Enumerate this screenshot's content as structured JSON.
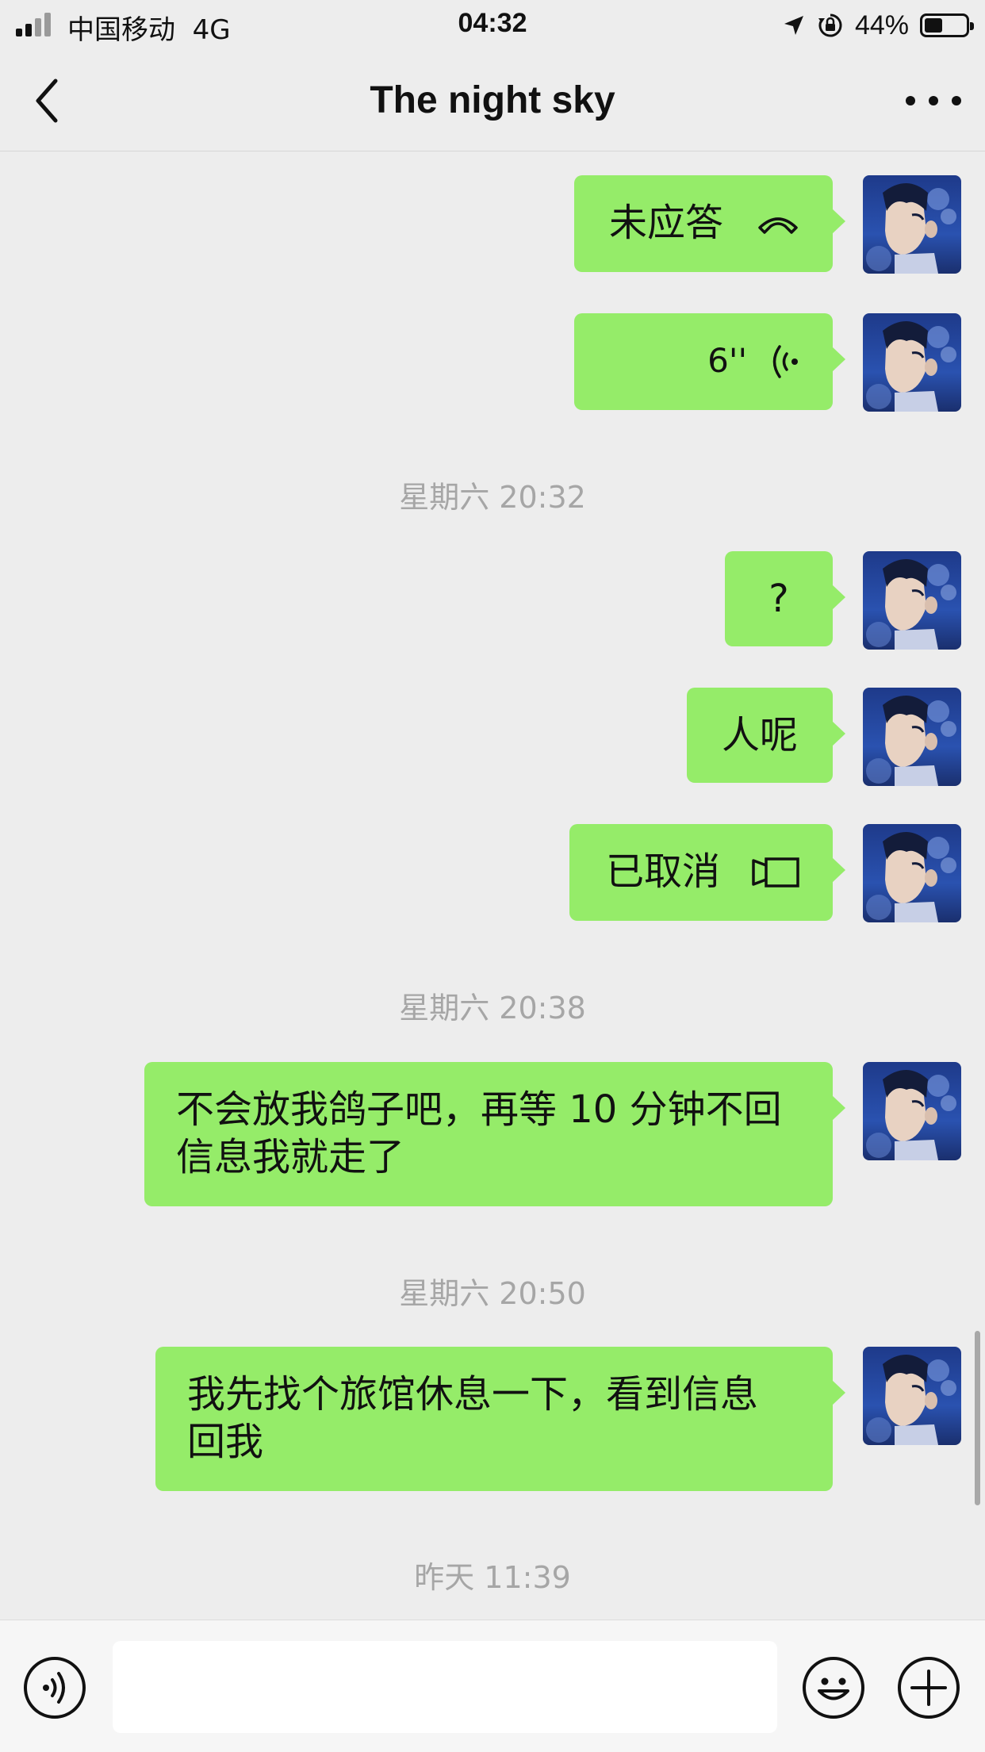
{
  "status_bar": {
    "carrier": "中国移动",
    "network": "4G",
    "time": "04:32",
    "battery_percent": "44%",
    "battery_level": 0.44,
    "icons": [
      "signal-icon",
      "location-arrow-icon",
      "orientation-lock-icon",
      "battery-icon"
    ]
  },
  "header": {
    "title": "The night sky",
    "back_icon": "chevron-left-icon",
    "more_icon": "more-dots-icon"
  },
  "messages": [
    {
      "type": "call",
      "text": "未应答",
      "icon": "phone-hangup-icon"
    },
    {
      "type": "voice",
      "text": "6''",
      "icon": "voice-wave-icon"
    },
    {
      "type": "timestamp",
      "text": "星期六 20:32"
    },
    {
      "type": "text",
      "text": "?"
    },
    {
      "type": "text",
      "text": "人呢"
    },
    {
      "type": "call",
      "text": "已取消",
      "icon": "video-call-icon"
    },
    {
      "type": "timestamp",
      "text": "星期六 20:38"
    },
    {
      "type": "text",
      "lines": [
        "不会放我鸽子吧，再等 10 分钟不回",
        "信息我就走了"
      ]
    },
    {
      "type": "timestamp",
      "text": "星期六 20:50"
    },
    {
      "type": "text",
      "lines": [
        "我先找个旅馆休息一下，看到信息",
        "回我"
      ]
    },
    {
      "type": "timestamp",
      "text": "昨天 11:39"
    }
  ],
  "input_bar": {
    "voice_icon": "voice-input-icon",
    "emoji_icon": "emoji-icon",
    "add_icon": "plus-icon",
    "value": ""
  },
  "colors": {
    "background": "#ededed",
    "bubble": "#95ec69",
    "timestamp": "#a6a6a6"
  }
}
